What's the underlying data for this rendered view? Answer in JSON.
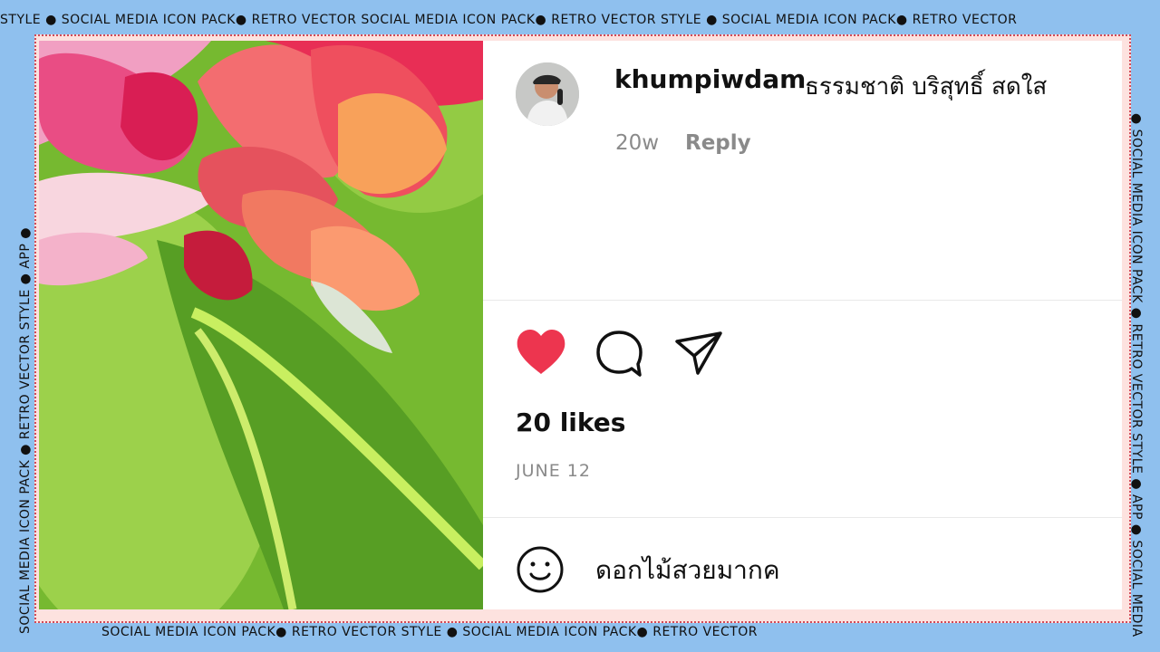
{
  "frame": {
    "top_text": "STYLE ● SOCIAL MEDIA ICON PACK● RETRO VECTOR   SOCIAL MEDIA ICON PACK● RETRO VECTOR STYLE ● SOCIAL MEDIA ICON PACK● RETRO VECTOR",
    "bottom_text": "SOCIAL MEDIA ICON PACK● RETRO VECTOR STYLE ● SOCIAL MEDIA ICON PACK● RETRO VECTOR",
    "left_text": "SOCIAL MEDIA ICON PACK ● RETRO VECTOR STYLE ● APP ●",
    "right_text": "● SOCIAL MEDIA ICON PACK ● RETRO VECTOR STYLE ● APP ● SOCIAL MEDIA"
  },
  "post": {
    "username": "khumpiwdam",
    "caption": "ธรรมชาติ บริสุทธิ์ สดใส",
    "time": "20w",
    "reply": "Reply",
    "likes": "20 likes",
    "date": "JUNE 12"
  },
  "icons": {
    "like": "heart-icon",
    "comment": "comment-bubble-icon",
    "share": "send-icon",
    "emoji": "emoji-icon"
  },
  "input": {
    "value": "ดอกไม้สวยมากค"
  },
  "colors": {
    "frame_blue": "#8fc0ee",
    "frame_pink": "#fde2df",
    "heart_red": "#ed354f",
    "photo_green": "#6fb52d"
  }
}
